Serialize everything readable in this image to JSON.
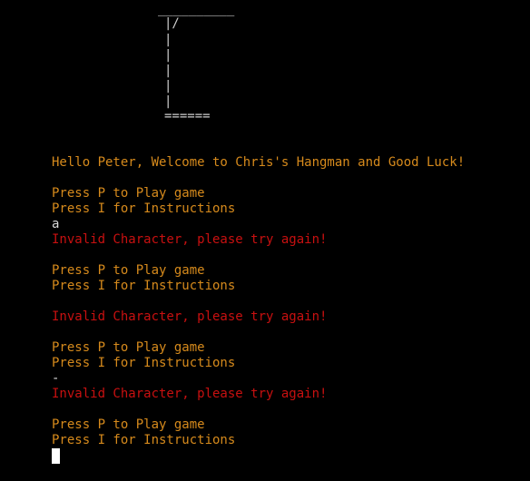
{
  "gallows": {
    "top": "__________",
    "row1": "|/",
    "row2": "|",
    "row3": "|",
    "row4": "|",
    "row5": "|",
    "row6": "|",
    "base": "======"
  },
  "console": {
    "welcome": "Hello Peter, Welcome to Chris's Hangman and Good Luck!",
    "prompt_play_1": "Press P to Play game",
    "prompt_instr_1": "Press I for Instructions",
    "input_1": "a",
    "error_1": "Invalid Character, please try again!",
    "prompt_play_2": "Press P to Play game",
    "prompt_instr_2": "Press I for Instructions",
    "error_2": "Invalid Character, please try again!",
    "prompt_play_3": "Press P to Play game",
    "prompt_instr_3": "Press I for Instructions",
    "input_3": "-",
    "error_3": "Invalid Character, please try again!",
    "prompt_play_4": "Press P to Play game",
    "prompt_instr_4": "Press I for Instructions"
  },
  "colors": {
    "background": "#000000",
    "prompt_text": "#d68a1c",
    "error_text": "#c81010",
    "user_input": "#d8d8d8",
    "cursor": "#ffffff"
  }
}
